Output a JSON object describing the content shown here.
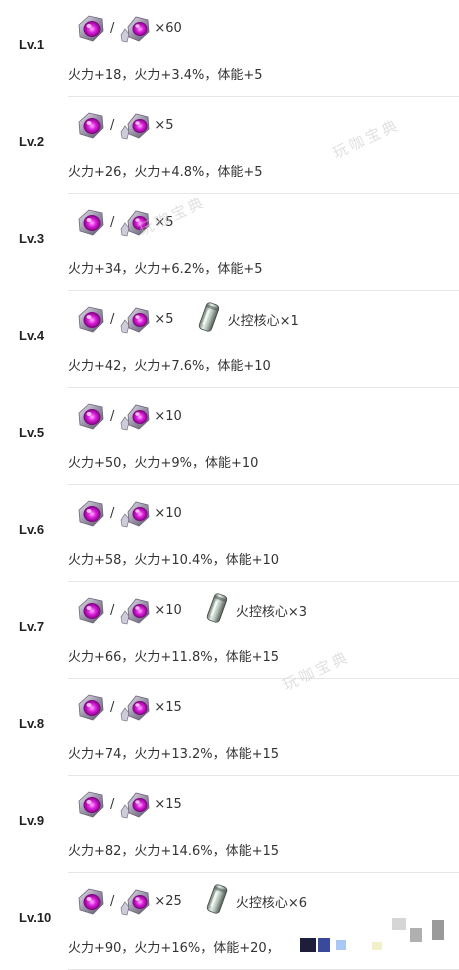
{
  "watermark_text": "玩咖宝典",
  "slash": "/",
  "icons": {
    "gem_a": "purple-gem-icon",
    "gem_b": "purple-crystal-cluster-icon",
    "core": "fire-control-core-canister-icon"
  },
  "levels": [
    {
      "label": "Lv.1",
      "count": "×60",
      "core_label": "",
      "stats": "火力+18，火力+3.4%，体能+5"
    },
    {
      "label": "Lv.2",
      "count": "×5",
      "core_label": "",
      "stats": "火力+26，火力+4.8%，体能+5"
    },
    {
      "label": "Lv.3",
      "count": "×5",
      "core_label": "",
      "stats": "火力+34，火力+6.2%，体能+5"
    },
    {
      "label": "Lv.4",
      "count": "×5",
      "core_label": "火控核心×1",
      "stats": "火力+42，火力+7.6%，体能+10"
    },
    {
      "label": "Lv.5",
      "count": "×10",
      "core_label": "",
      "stats": "火力+50，火力+9%，体能+10"
    },
    {
      "label": "Lv.6",
      "count": "×10",
      "core_label": "",
      "stats": "火力+58，火力+10.4%，体能+10"
    },
    {
      "label": "Lv.7",
      "count": "×10",
      "core_label": "火控核心×3",
      "stats": "火力+66，火力+11.8%，体能+15"
    },
    {
      "label": "Lv.8",
      "count": "×15",
      "core_label": "",
      "stats": "火力+74，火力+13.2%，体能+15"
    },
    {
      "label": "Lv.9",
      "count": "×15",
      "core_label": "",
      "stats": "火力+82，火力+14.6%，体能+15"
    },
    {
      "label": "Lv.10",
      "count": "×25",
      "core_label": "火控核心×6",
      "stats": "火力+90，火力+16%，体能+20，"
    }
  ]
}
